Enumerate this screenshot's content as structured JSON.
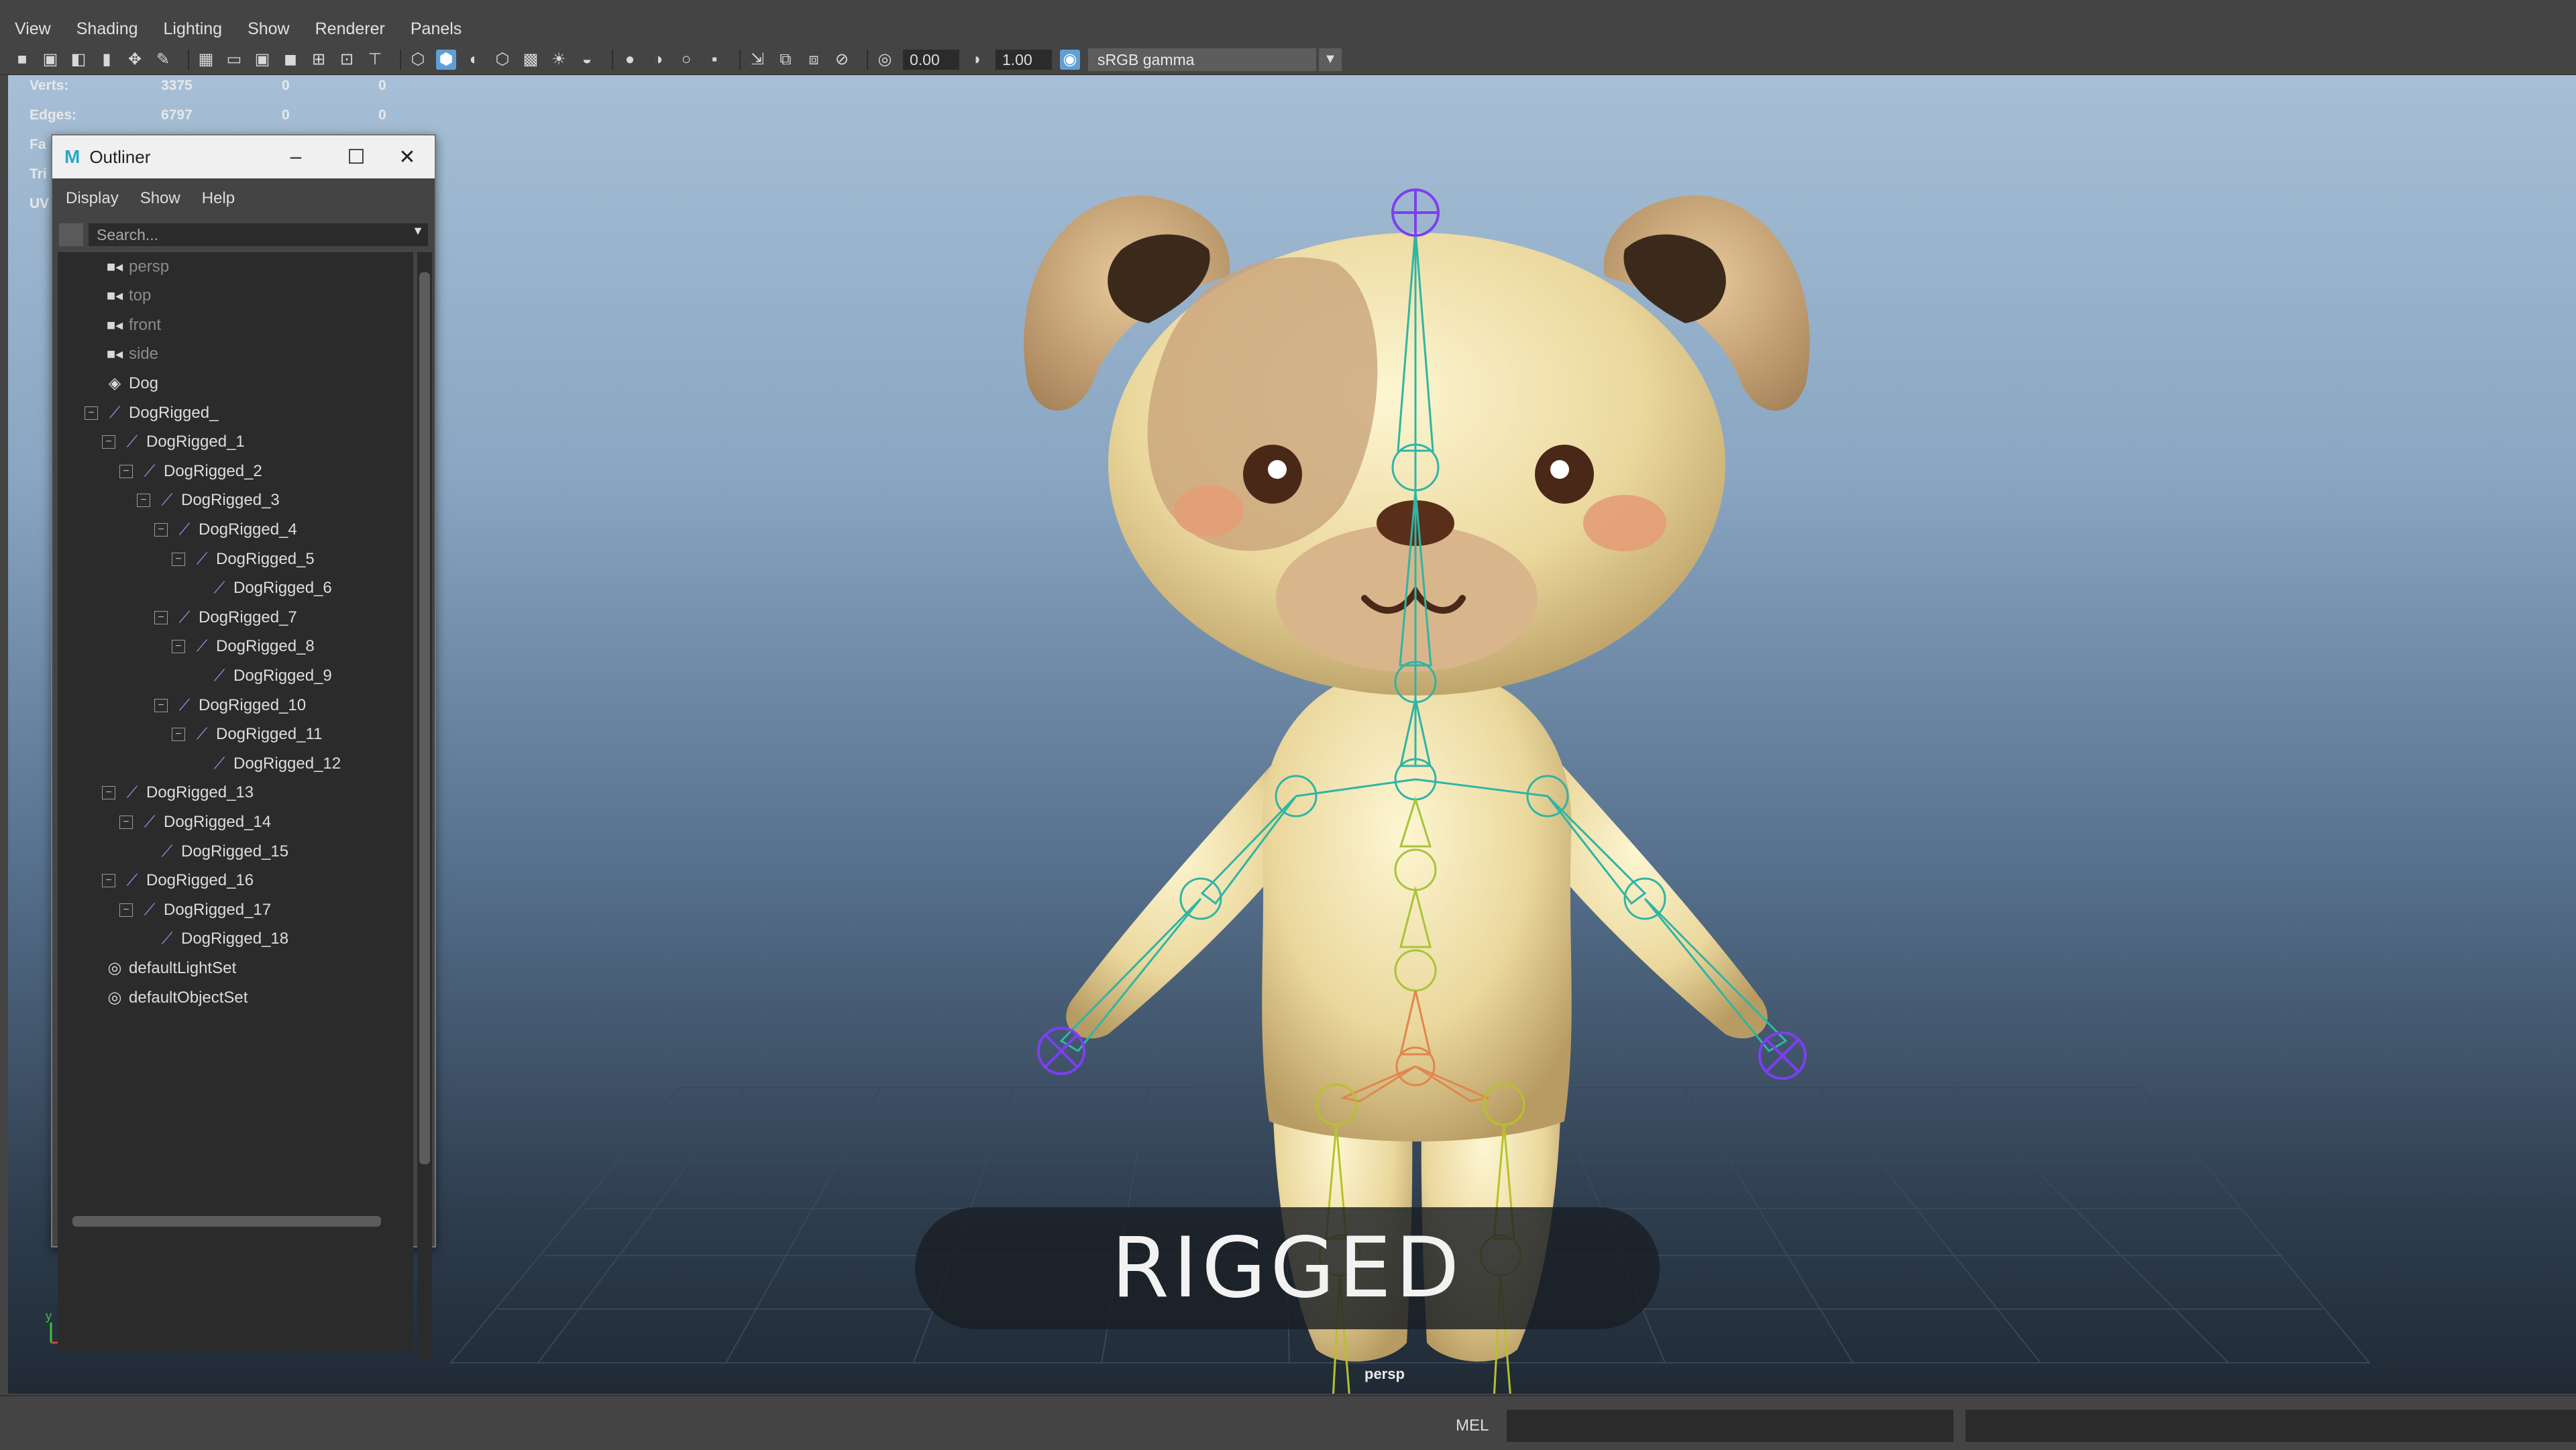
{
  "menubar": {
    "items": [
      "View",
      "Shading",
      "Lighting",
      "Show",
      "Renderer",
      "Panels"
    ]
  },
  "toolbar": {
    "exposure": "0.00",
    "gamma": "1.00",
    "color_space": "sRGB gamma"
  },
  "hud": {
    "verts": {
      "label": "Verts:",
      "values": [
        "3375",
        "0",
        "0"
      ]
    },
    "edges": {
      "label": "Edges:",
      "values": [
        "6797",
        "0",
        "0"
      ]
    },
    "partial": [
      "Fa",
      "Tri",
      "UV"
    ]
  },
  "outliner": {
    "title": "Outliner",
    "menu": [
      "Display",
      "Show",
      "Help"
    ],
    "search_placeholder": "Search...",
    "items": [
      {
        "label": "persp",
        "type": "camera",
        "depth": 0,
        "dim": true
      },
      {
        "label": "top",
        "type": "camera",
        "depth": 0,
        "dim": true
      },
      {
        "label": "front",
        "type": "camera",
        "depth": 0,
        "dim": true
      },
      {
        "label": "side",
        "type": "camera",
        "depth": 0,
        "dim": true
      },
      {
        "label": "Dog",
        "type": "mesh",
        "depth": 0,
        "dim": false
      },
      {
        "label": "DogRigged_",
        "type": "joint",
        "depth": 0,
        "dim": false
      },
      {
        "label": "DogRigged_1",
        "type": "joint",
        "depth": 1,
        "dim": false
      },
      {
        "label": "DogRigged_2",
        "type": "joint",
        "depth": 2,
        "dim": false
      },
      {
        "label": "DogRigged_3",
        "type": "joint",
        "depth": 3,
        "dim": false
      },
      {
        "label": "DogRigged_4",
        "type": "joint",
        "depth": 4,
        "dim": false
      },
      {
        "label": "DogRigged_5",
        "type": "joint",
        "depth": 5,
        "dim": false
      },
      {
        "label": "DogRigged_6",
        "type": "joint",
        "depth": 6,
        "dim": false
      },
      {
        "label": "DogRigged_7",
        "type": "joint",
        "depth": 4,
        "dim": false
      },
      {
        "label": "DogRigged_8",
        "type": "joint",
        "depth": 5,
        "dim": false
      },
      {
        "label": "DogRigged_9",
        "type": "joint",
        "depth": 6,
        "dim": false
      },
      {
        "label": "DogRigged_10",
        "type": "joint",
        "depth": 4,
        "dim": false
      },
      {
        "label": "DogRigged_11",
        "type": "joint",
        "depth": 5,
        "dim": false
      },
      {
        "label": "DogRigged_12",
        "type": "joint",
        "depth": 6,
        "dim": false
      },
      {
        "label": "DogRigged_13",
        "type": "joint",
        "depth": 1,
        "dim": false
      },
      {
        "label": "DogRigged_14",
        "type": "joint",
        "depth": 2,
        "dim": false
      },
      {
        "label": "DogRigged_15",
        "type": "joint",
        "depth": 3,
        "dim": false
      },
      {
        "label": "DogRigged_16",
        "type": "joint",
        "depth": 1,
        "dim": false
      },
      {
        "label": "DogRigged_17",
        "type": "joint",
        "depth": 2,
        "dim": false
      },
      {
        "label": "DogRigged_18",
        "type": "joint",
        "depth": 3,
        "dim": false
      },
      {
        "label": "defaultLightSet",
        "type": "set",
        "depth": 0,
        "dim": false
      },
      {
        "label": "defaultObjectSet",
        "type": "set",
        "depth": 0,
        "dim": false
      }
    ]
  },
  "viewport": {
    "camera_label": "persp",
    "caption": "RIGGED"
  },
  "statusbar": {
    "mel_label": "MEL"
  },
  "colors": {
    "accent": "#5f9fd6",
    "joint_icon": "#9f8fe8",
    "dog_body": "#efdfa6",
    "dog_patch": "#c9a47a"
  }
}
